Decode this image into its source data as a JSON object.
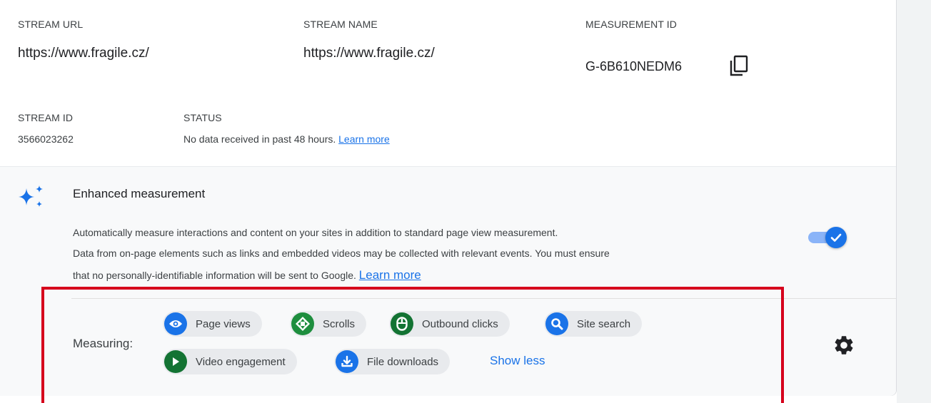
{
  "stream": {
    "url_label": "STREAM URL",
    "url_value": "https://www.fragile.cz/",
    "name_label": "STREAM NAME",
    "name_value": "https://www.fragile.cz/",
    "mid_label": "MEASUREMENT ID",
    "mid_value": "G-6B610NEDM6",
    "id_label": "STREAM ID",
    "id_value": "3566023262",
    "status_label": "STATUS",
    "status_text": "No data received in past 48 hours.",
    "status_link": "Learn more"
  },
  "enhanced": {
    "title": "Enhanced measurement",
    "desc_line1": "Automatically measure interactions and content on your sites in addition to standard page view measurement.",
    "desc_line2": "Data from on-page elements such as links and embedded videos may be collected with relevant events. You must ensure",
    "desc_line3": "that no personally-identifiable information will be sent to Google.",
    "learn_more": "Learn more",
    "toggle_on": true,
    "measuring_label": "Measuring:",
    "chips": [
      {
        "label": "Page views",
        "icon": "eye-icon",
        "color": "#1a73e8"
      },
      {
        "label": "Scrolls",
        "icon": "scroll-arrows-icon",
        "color": "#1e8e3e"
      },
      {
        "label": "Outbound clicks",
        "icon": "mouse-icon",
        "color": "#137333"
      },
      {
        "label": "Site search",
        "icon": "search-icon",
        "color": "#1a73e8"
      },
      {
        "label": "Video engagement",
        "icon": "play-icon",
        "color": "#137333"
      },
      {
        "label": "File downloads",
        "icon": "download-icon",
        "color": "#1a73e8"
      }
    ],
    "show_less": "Show less"
  },
  "colors": {
    "accent": "#1a73e8",
    "highlight_box": "#d6001c"
  }
}
